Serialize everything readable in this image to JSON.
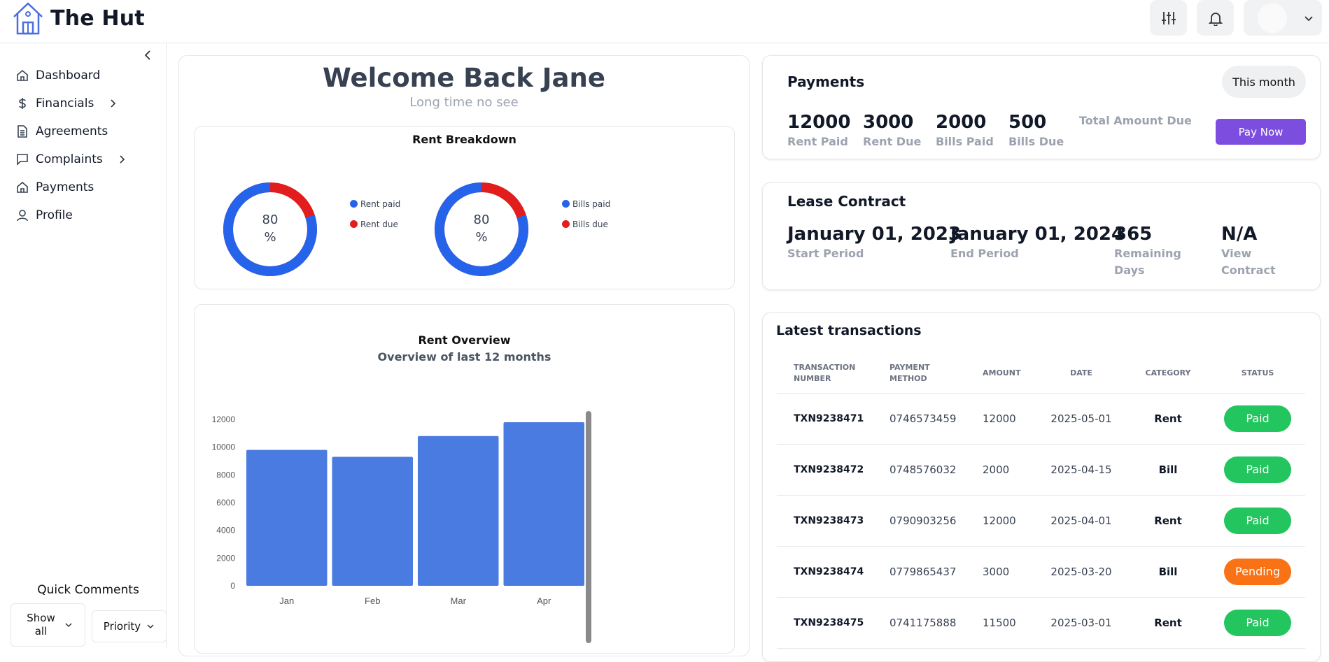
{
  "app": {
    "title": "The Hut"
  },
  "sidebar": {
    "items": [
      {
        "label": "Dashboard",
        "icon": "home-icon"
      },
      {
        "label": "Financials",
        "icon": "dollar-icon",
        "has_submenu": true
      },
      {
        "label": "Agreements",
        "icon": "document-icon"
      },
      {
        "label": "Complaints",
        "icon": "chat-icon",
        "has_submenu": true
      },
      {
        "label": "Payments",
        "icon": "home-icon"
      },
      {
        "label": "Profile",
        "icon": "user-icon"
      }
    ],
    "quick_comments": {
      "title": "Quick Comments",
      "show_all": "Show all",
      "priority": "Priority"
    }
  },
  "welcome": {
    "title": "Welcome Back Jane",
    "subtitle": "Long time no see"
  },
  "rent_breakdown": {
    "title": "Rent Breakdown",
    "rent": {
      "percent_label": "80",
      "unit": "%",
      "legend_paid": "Rent paid",
      "legend_due": "Rent due",
      "paid_fraction": 0.8
    },
    "bills": {
      "percent_label": "80",
      "unit": "%",
      "legend_paid": "Bills paid",
      "legend_due": "Bills due",
      "paid_fraction": 0.8
    },
    "colors": {
      "paid": "#2563eb",
      "due": "#e11d1d"
    }
  },
  "chart_data": {
    "type": "bar",
    "title": "Rent Overview",
    "subtitle": "Overview of last 12 months",
    "categories": [
      "Jan",
      "Feb",
      "Mar",
      "Apr"
    ],
    "values": [
      9800,
      9300,
      10800,
      11800
    ],
    "ylim": [
      0,
      12000
    ],
    "yticks": [
      0,
      2000,
      4000,
      6000,
      8000,
      10000,
      12000
    ],
    "color": "#4a7be0",
    "grid": false
  },
  "payments": {
    "title": "Payments",
    "period_button": "This month",
    "stats": [
      {
        "value": "12000",
        "label": "Rent Paid"
      },
      {
        "value": "3000",
        "label": "Rent Due"
      },
      {
        "value": "2000",
        "label": "Bills Paid"
      },
      {
        "value": "500",
        "label": "Bills Due"
      }
    ],
    "total_label": "Total Amount Due",
    "pay_button": "Pay Now"
  },
  "lease": {
    "title": "Lease Contract",
    "start": {
      "value": "January 01, 2023",
      "label": "Start Period"
    },
    "end": {
      "value": "January 01, 2024",
      "label": "End Period"
    },
    "remaining": {
      "value": "365",
      "label": "Remaining Days"
    },
    "contract": {
      "value": "N/A",
      "label": "View Contract"
    }
  },
  "transactions": {
    "title": "Latest transactions",
    "headers": [
      "TRANSACTION NUMBER",
      "PAYMENT METHOD",
      "AMOUNT",
      "DATE",
      "CATEGORY",
      "STATUS"
    ],
    "rows": [
      {
        "txn": "TXN9238471",
        "method": "0746573459",
        "amount": "12000",
        "date": "2025-05-01",
        "category": "Rent",
        "status": "Paid"
      },
      {
        "txn": "TXN9238472",
        "method": "0748576032",
        "amount": "2000",
        "date": "2025-04-15",
        "category": "Bill",
        "status": "Paid"
      },
      {
        "txn": "TXN9238473",
        "method": "0790903256",
        "amount": "12000",
        "date": "2025-04-01",
        "category": "Rent",
        "status": "Paid"
      },
      {
        "txn": "TXN9238474",
        "method": "0779865437",
        "amount": "3000",
        "date": "2025-03-20",
        "category": "Bill",
        "status": "Pending"
      },
      {
        "txn": "TXN9238475",
        "method": "0741175888",
        "amount": "11500",
        "date": "2025-03-01",
        "category": "Rent",
        "status": "Paid"
      }
    ],
    "status_colors": {
      "Paid": "#22c55e",
      "Pending": "#f97316"
    }
  }
}
